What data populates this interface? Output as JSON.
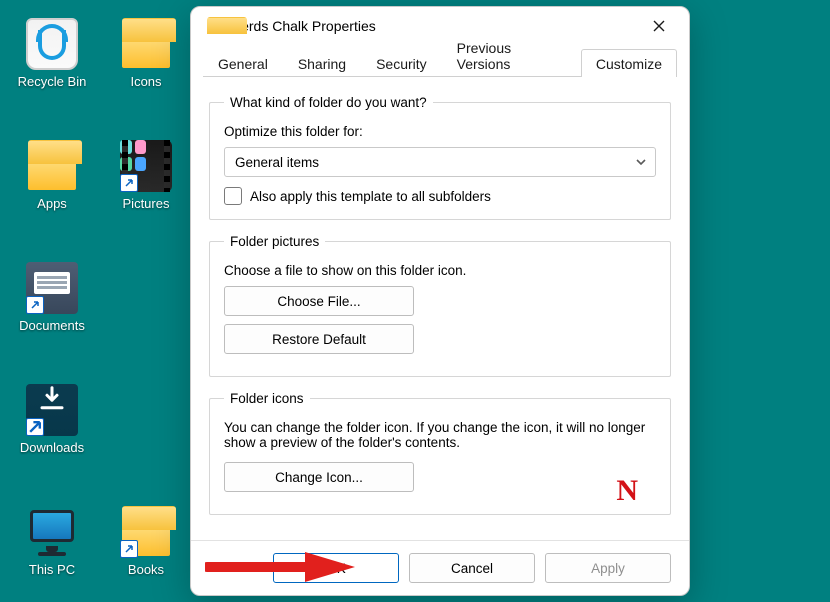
{
  "desktop": {
    "icons": [
      {
        "id": "recycle-bin",
        "label": "Recycle Bin"
      },
      {
        "id": "icons",
        "label": "Icons"
      },
      {
        "id": "apps",
        "label": "Apps"
      },
      {
        "id": "pictures",
        "label": "Pictures"
      },
      {
        "id": "documents",
        "label": "Documents"
      },
      {
        "id": "downloads",
        "label": "Downloads"
      },
      {
        "id": "this-pc",
        "label": "This PC"
      },
      {
        "id": "books",
        "label": "Books"
      }
    ]
  },
  "dialog": {
    "title": "Nerds Chalk Properties",
    "tabs": {
      "general": "General",
      "sharing": "Sharing",
      "security": "Security",
      "previous": "Previous Versions",
      "customize": "Customize"
    },
    "kind": {
      "legend": "What kind of folder do you want?",
      "optimize_label": "Optimize this folder for:",
      "select_value": "General items",
      "subfolders_label": "Also apply this template to all subfolders"
    },
    "pictures": {
      "legend": "Folder pictures",
      "hint": "Choose a file to show on this folder icon.",
      "choose": "Choose File...",
      "restore": "Restore Default"
    },
    "icons": {
      "legend": "Folder icons",
      "hint": "You can change the folder icon. If you change the icon, it will no longer show a preview of the folder's contents.",
      "change": "Change Icon...",
      "preview_letter": "N"
    },
    "buttons": {
      "ok": "OK",
      "cancel": "Cancel",
      "apply": "Apply"
    }
  }
}
